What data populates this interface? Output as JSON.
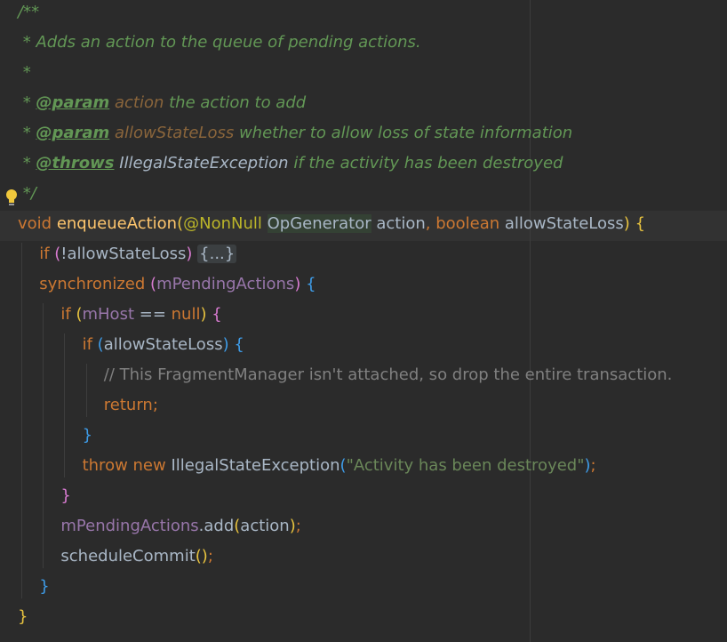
{
  "editor": {
    "colors": {
      "background": "#2b2b2b",
      "keyword": "#cc7832",
      "doc_comment": "#629755",
      "field": "#9876aa",
      "string": "#6a8759",
      "comment": "#808080",
      "annotation": "#bbb529"
    },
    "gutter": {
      "intention_icon": "lightbulb-icon"
    },
    "lines": [
      {
        "indent": 0,
        "tokens": [
          {
            "t": "/**",
            "c": "doc"
          }
        ]
      },
      {
        "indent": 0,
        "tokens": [
          {
            "t": " * Adds an action to the queue of pending actions.",
            "c": "doc"
          }
        ]
      },
      {
        "indent": 0,
        "tokens": [
          {
            "t": " *",
            "c": "doc"
          }
        ]
      },
      {
        "indent": 0,
        "tokens": [
          {
            "t": " * ",
            "c": "doc"
          },
          {
            "t": "@param",
            "c": "tag"
          },
          {
            "t": " ",
            "c": "doc"
          },
          {
            "t": "action",
            "c": "pname"
          },
          {
            "t": " the action to add",
            "c": "doc"
          }
        ]
      },
      {
        "indent": 0,
        "tokens": [
          {
            "t": " * ",
            "c": "doc"
          },
          {
            "t": "@param",
            "c": "tag"
          },
          {
            "t": " ",
            "c": "doc"
          },
          {
            "t": "allowStateLoss",
            "c": "pname"
          },
          {
            "t": " whether to allow loss of state information",
            "c": "doc"
          }
        ]
      },
      {
        "indent": 0,
        "tokens": [
          {
            "t": " * ",
            "c": "doc"
          },
          {
            "t": "@throws",
            "c": "tag"
          },
          {
            "t": " ",
            "c": "doc"
          },
          {
            "t": "IllegalStateException",
            "c": "doccls"
          },
          {
            "t": " if the activity has been destroyed",
            "c": "doc"
          }
        ]
      },
      {
        "indent": 0,
        "tokens": [
          {
            "t": " */",
            "c": "doc"
          }
        ]
      },
      {
        "indent": 0,
        "tokens": [
          {
            "t": "void ",
            "c": "kw"
          },
          {
            "t": "enqueueAction",
            "c": "method"
          },
          {
            "t": "(",
            "c": "paren-y"
          },
          {
            "t": "@NonNull",
            "c": "anno"
          },
          {
            "t": " ",
            "c": "plain"
          },
          {
            "t": "OpGenerator",
            "c": "type-hl"
          },
          {
            "t": " action",
            "c": "plain"
          },
          {
            "t": ", ",
            "c": "kw"
          },
          {
            "t": "boolean ",
            "c": "kw"
          },
          {
            "t": "allowStateLoss",
            "c": "plain"
          },
          {
            "t": ")",
            "c": "paren-y"
          },
          {
            "t": " ",
            "c": "plain"
          },
          {
            "t": "{",
            "c": "paren-y"
          }
        ]
      },
      {
        "indent": 1,
        "tokens": [
          {
            "t": "if ",
            "c": "kw"
          },
          {
            "t": "(",
            "c": "paren-p"
          },
          {
            "t": "!allowStateLoss",
            "c": "plain"
          },
          {
            "t": ")",
            "c": "paren-p"
          },
          {
            "t": " ",
            "c": "plain"
          },
          {
            "t": "{...}",
            "c": "fold"
          }
        ]
      },
      {
        "indent": 1,
        "tokens": [
          {
            "t": "synchronized ",
            "c": "kw"
          },
          {
            "t": "(",
            "c": "paren-p"
          },
          {
            "t": "mPendingActions",
            "c": "field"
          },
          {
            "t": ")",
            "c": "paren-p"
          },
          {
            "t": " ",
            "c": "plain"
          },
          {
            "t": "{",
            "c": "paren-b"
          }
        ]
      },
      {
        "indent": 2,
        "tokens": [
          {
            "t": "if ",
            "c": "kw"
          },
          {
            "t": "(",
            "c": "paren-y"
          },
          {
            "t": "mHost",
            "c": "field"
          },
          {
            "t": " == ",
            "c": "plain"
          },
          {
            "t": "null",
            "c": "kw"
          },
          {
            "t": ")",
            "c": "paren-y"
          },
          {
            "t": " ",
            "c": "plain"
          },
          {
            "t": "{",
            "c": "paren-p"
          }
        ]
      },
      {
        "indent": 3,
        "tokens": [
          {
            "t": "if ",
            "c": "kw"
          },
          {
            "t": "(",
            "c": "paren-b"
          },
          {
            "t": "allowStateLoss",
            "c": "plain"
          },
          {
            "t": ")",
            "c": "paren-b"
          },
          {
            "t": " ",
            "c": "plain"
          },
          {
            "t": "{",
            "c": "paren-b"
          }
        ]
      },
      {
        "indent": 4,
        "tokens": [
          {
            "t": "// This FragmentManager isn't attached, so drop the entire transaction.",
            "c": "cmt"
          }
        ]
      },
      {
        "indent": 4,
        "tokens": [
          {
            "t": "return;",
            "c": "kw"
          }
        ]
      },
      {
        "indent": 3,
        "tokens": [
          {
            "t": "}",
            "c": "paren-b"
          }
        ]
      },
      {
        "indent": 3,
        "tokens": [
          {
            "t": "throw new ",
            "c": "kw"
          },
          {
            "t": "IllegalStateException",
            "c": "plain"
          },
          {
            "t": "(",
            "c": "paren-b"
          },
          {
            "t": "\"Activity has been destroyed\"",
            "c": "str"
          },
          {
            "t": ")",
            "c": "paren-b"
          },
          {
            "t": ";",
            "c": "kw"
          }
        ]
      },
      {
        "indent": 2,
        "tokens": [
          {
            "t": "}",
            "c": "paren-p"
          }
        ]
      },
      {
        "indent": 2,
        "tokens": [
          {
            "t": "mPendingActions",
            "c": "field"
          },
          {
            "t": ".",
            "c": "plain"
          },
          {
            "t": "add",
            "c": "plain"
          },
          {
            "t": "(",
            "c": "paren-y"
          },
          {
            "t": "action",
            "c": "plain"
          },
          {
            "t": ")",
            "c": "paren-y"
          },
          {
            "t": ";",
            "c": "kw"
          }
        ]
      },
      {
        "indent": 2,
        "tokens": [
          {
            "t": "scheduleCommit",
            "c": "plain"
          },
          {
            "t": "(",
            "c": "paren-y"
          },
          {
            "t": ")",
            "c": "paren-y"
          },
          {
            "t": ";",
            "c": "kw"
          }
        ]
      },
      {
        "indent": 1,
        "tokens": [
          {
            "t": "}",
            "c": "paren-b"
          }
        ]
      },
      {
        "indent": 0,
        "tokens": [
          {
            "t": "}",
            "c": "paren-y"
          }
        ]
      }
    ]
  }
}
